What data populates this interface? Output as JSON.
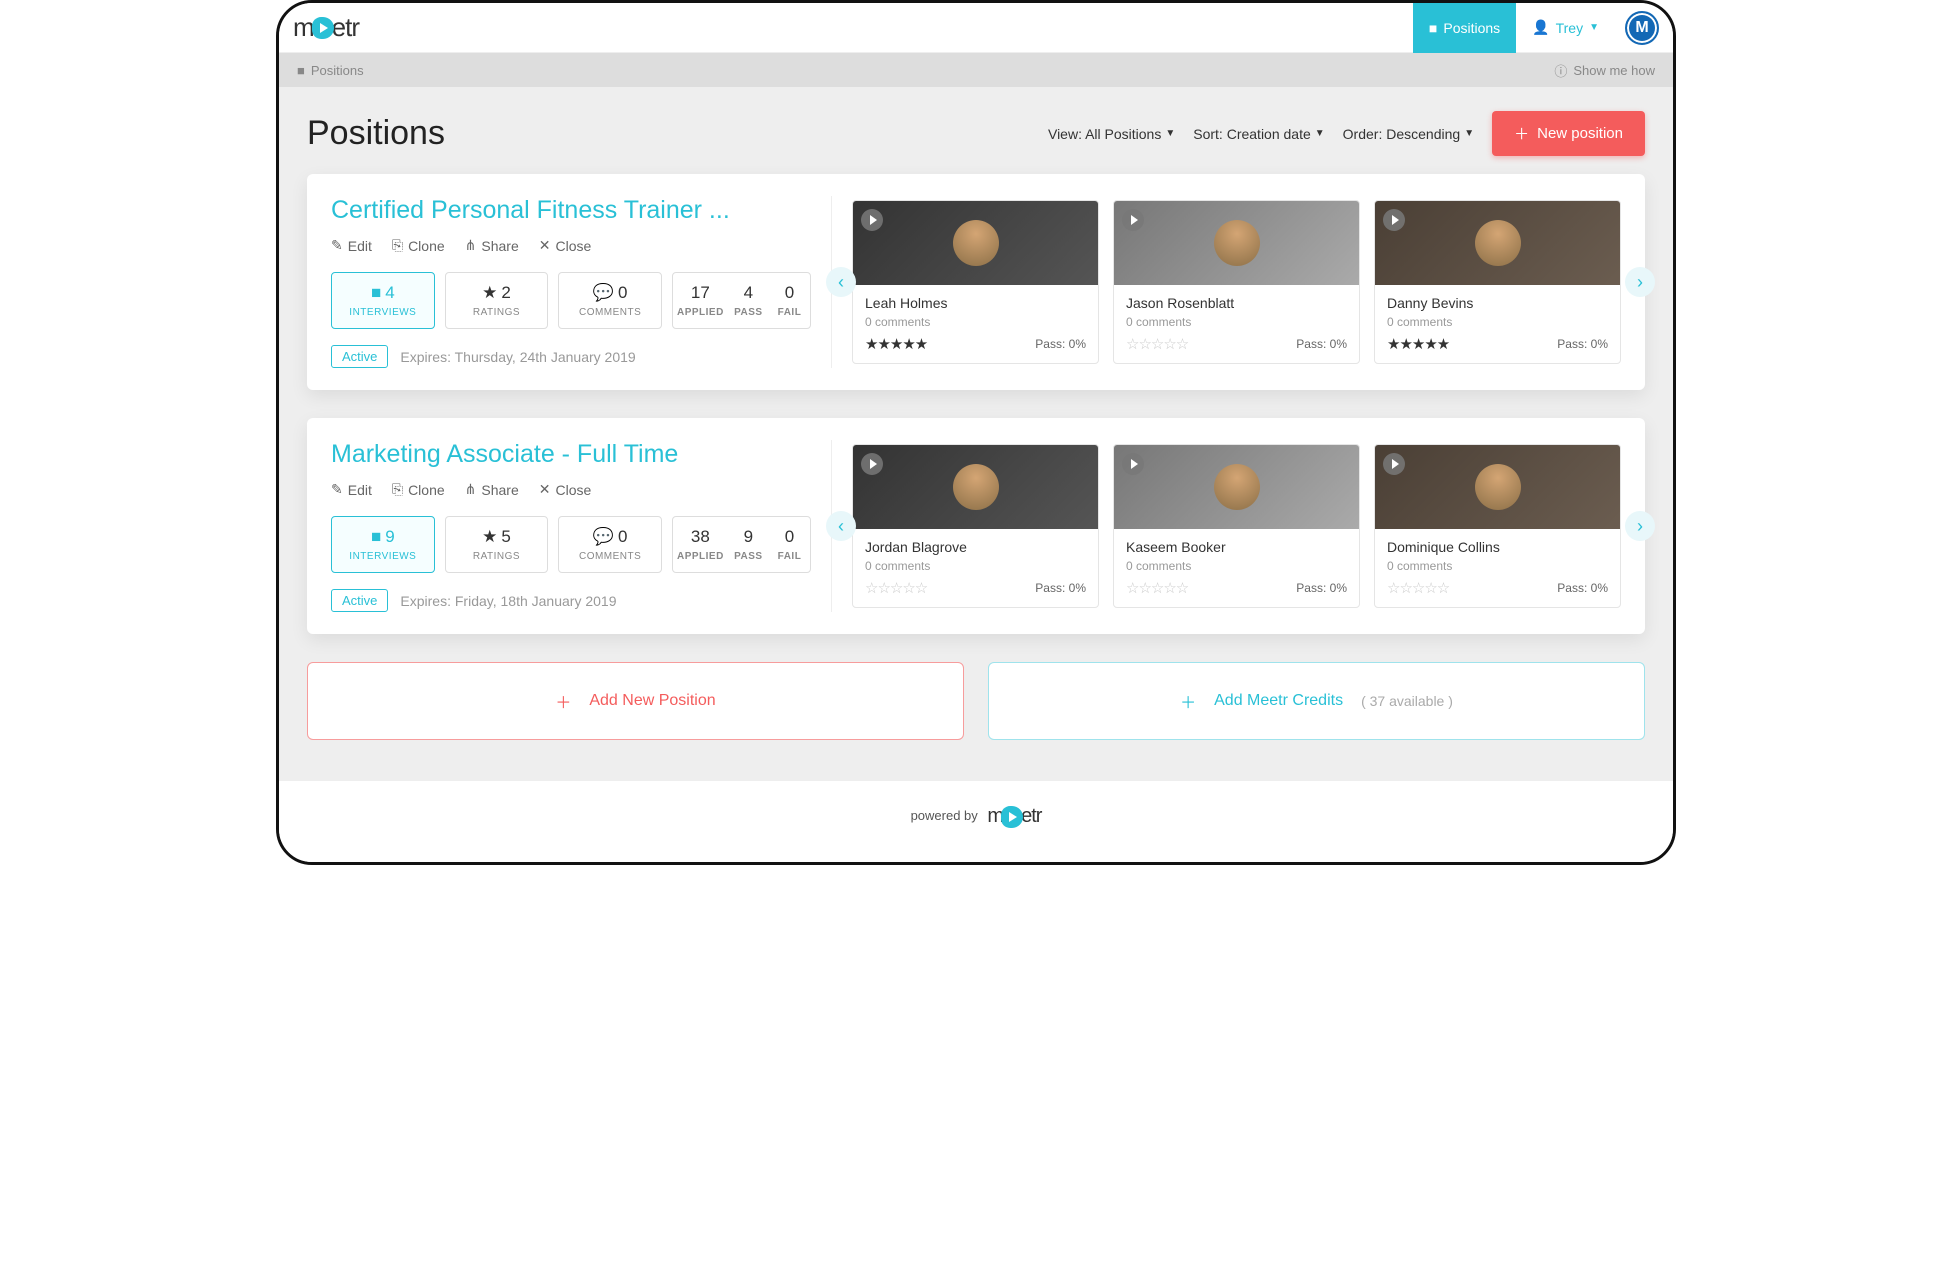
{
  "nav": {
    "positions_label": "Positions",
    "user_name": "Trey",
    "avatar_letter": "M"
  },
  "subbar": {
    "breadcrumb": "Positions",
    "help": "Show me how"
  },
  "page": {
    "title": "Positions",
    "view_label": "View: All Positions",
    "sort_label": "Sort: Creation date",
    "order_label": "Order: Descending",
    "new_position_btn": "New position"
  },
  "positions": [
    {
      "title": "Certified Personal Fitness Trainer ...",
      "actions": {
        "edit": "Edit",
        "clone": "Clone",
        "share": "Share",
        "close": "Close"
      },
      "interviews": "4",
      "interviews_label": "INTERVIEWS",
      "ratings": "2",
      "ratings_label": "RATINGS",
      "comments": "0",
      "comments_label": "COMMENTS",
      "applied": "17",
      "applied_label": "APPLIED",
      "pass": "4",
      "pass_label": "PASS",
      "fail": "0",
      "fail_label": "FAIL",
      "status": "Active",
      "expires": "Expires: Thursday, 24th January 2019",
      "candidates": [
        {
          "name": "Leah Holmes",
          "comments": "0 comments",
          "stars_full": true,
          "pass": "Pass: 0%"
        },
        {
          "name": "Jason Rosenblatt",
          "comments": "0 comments",
          "stars_full": false,
          "pass": "Pass: 0%"
        },
        {
          "name": "Danny Bevins",
          "comments": "0 comments",
          "stars_full": true,
          "pass": "Pass: 0%"
        }
      ]
    },
    {
      "title": "Marketing Associate - Full Time",
      "actions": {
        "edit": "Edit",
        "clone": "Clone",
        "share": "Share",
        "close": "Close"
      },
      "interviews": "9",
      "interviews_label": "INTERVIEWS",
      "ratings": "5",
      "ratings_label": "RATINGS",
      "comments": "0",
      "comments_label": "COMMENTS",
      "applied": "38",
      "applied_label": "APPLIED",
      "pass": "9",
      "pass_label": "PASS",
      "fail": "0",
      "fail_label": "FAIL",
      "status": "Active",
      "expires": "Expires: Friday, 18th January 2019",
      "candidates": [
        {
          "name": "Jordan Blagrove",
          "comments": "0 comments",
          "stars_full": false,
          "pass": "Pass: 0%"
        },
        {
          "name": "Kaseem Booker",
          "comments": "0 comments",
          "stars_full": false,
          "pass": "Pass: 0%"
        },
        {
          "name": "Dominique Collins",
          "comments": "0 comments",
          "stars_full": false,
          "pass": "Pass: 0%"
        }
      ]
    }
  ],
  "bottom": {
    "add_position": "Add New Position",
    "add_credits": "Add Meetr Credits",
    "credits_available": "( 37 available )"
  },
  "footer": {
    "powered": "powered by"
  }
}
